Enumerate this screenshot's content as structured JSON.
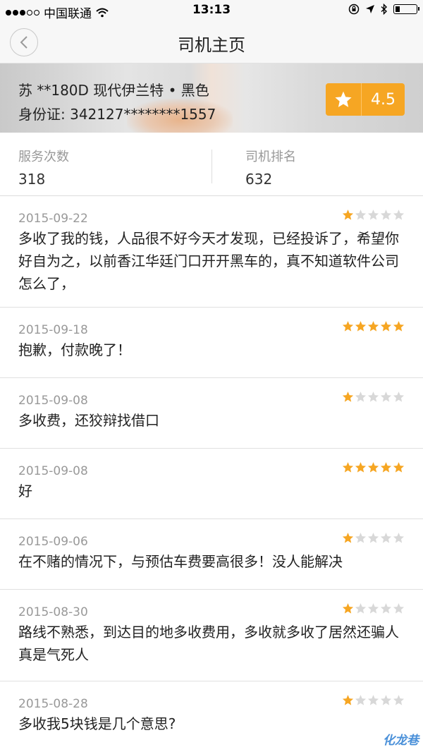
{
  "status_bar": {
    "carrier": "中国联通",
    "time": "13:13",
    "signal_level": 3
  },
  "nav": {
    "title": "司机主页"
  },
  "driver": {
    "plate": "苏 **180D 现代伊兰特 • 黑色",
    "id_card": "身份证: 342127********1557",
    "rating": "4.5"
  },
  "stats": {
    "service_label": "服务次数",
    "service_value": "318",
    "rank_label": "司机排名",
    "rank_value": "632"
  },
  "reviews": [
    {
      "date": "2015-09-22",
      "stars": 1,
      "text": "多收了我的钱，人品很不好今天才发现，已经投诉了，希望你好自为之，以前香江华廷门口开开黑车的，真不知道软件公司怎么了，"
    },
    {
      "date": "2015-09-18",
      "stars": 5,
      "text": "抱歉，付款晚了！"
    },
    {
      "date": "2015-09-08",
      "stars": 1,
      "text": "多收费，还狡辩找借口"
    },
    {
      "date": "2015-09-08",
      "stars": 5,
      "text": "好"
    },
    {
      "date": "2015-09-06",
      "stars": 1,
      "text": "在不赌的情况下，与预估车费要高很多！没人能解决"
    },
    {
      "date": "2015-08-30",
      "stars": 1,
      "text": "路线不熟悉，到达目的地多收费用，多收就多收了居然还骗人真是气死人"
    },
    {
      "date": "2015-08-28",
      "stars": 1,
      "text": "多收我5块钱是几个意思?"
    }
  ],
  "watermark": "化龙巷",
  "colors": {
    "accent": "#f6a623",
    "star_on": "#f6a623",
    "star_off": "#d8d8d8"
  }
}
